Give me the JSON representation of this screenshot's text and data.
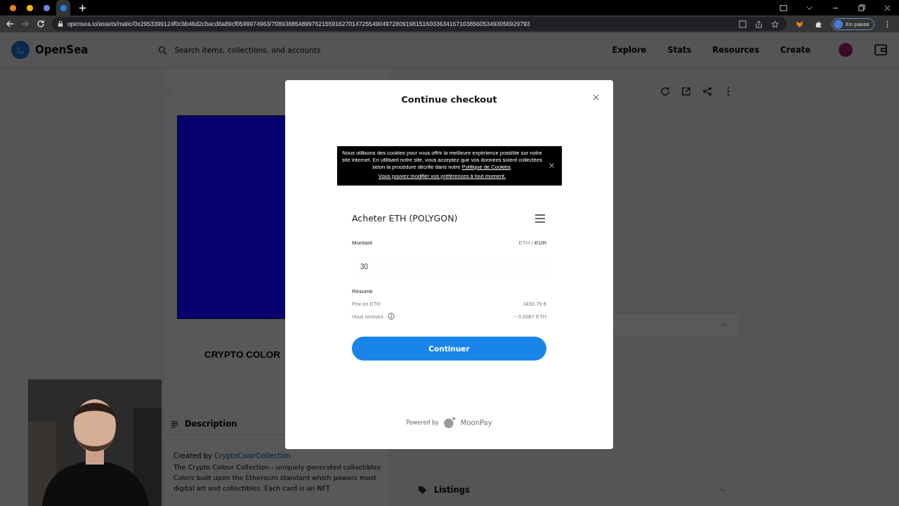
{
  "browser": {
    "tabs": [
      {
        "selected": false
      },
      {
        "selected": false
      },
      {
        "selected": false
      },
      {
        "selected": true
      }
    ],
    "url": "opensea.io/assets/matic/0x2953399124f0cbb46d2cbacd8a89cf0599974963/70893885489976215591627014725549049728091981516033634167103856053493056929793",
    "profile": "En pause"
  },
  "header": {
    "brand": "OpenSea",
    "search": {
      "placeholder": "Search items, collections, and accounts"
    },
    "nav": [
      "Explore",
      "Stats",
      "Resources",
      "Create"
    ]
  },
  "item": {
    "title": "CRYPTO COLOR",
    "description": {
      "heading": "Description",
      "created_by": "Created by",
      "creator": "CryptoColorCollection",
      "text": "The Crypto Colour Collection - uniquely generated collectibles Colors built upon the Ethereum standard which powers most digital art and collectibles. Each card is an NFT"
    },
    "listings": "Listings"
  },
  "modal": {
    "title": "Continue checkout",
    "cookie_banner": {
      "text": "Nous utilisons des cookies pour vous offrir la meilleure expérience possible sur notre site internet. En utilisant notre site, vous acceptez que vos données soient collectées selon la procédure décrite dans notre",
      "link": "Politique de Cookies",
      "after": ".",
      "preferences": "Vous pouvez modifier vos préférences à tout moment."
    },
    "widget_title": "Acheter ETH (POLYGON)",
    "amount_label": "Montant",
    "currency_toggle": "ETH / **EUR**",
    "amount": "30",
    "summary_title": "Résumé",
    "summary": [
      {
        "label": "Prix en ETH",
        "value": "3450.79 €",
        "info": false
      },
      {
        "label": "Vous recevez",
        "value": "~ 0.0087 ETH",
        "info": true
      }
    ],
    "button": "Continuer",
    "powered_by": "Powered by",
    "provider": "MoonPay"
  }
}
